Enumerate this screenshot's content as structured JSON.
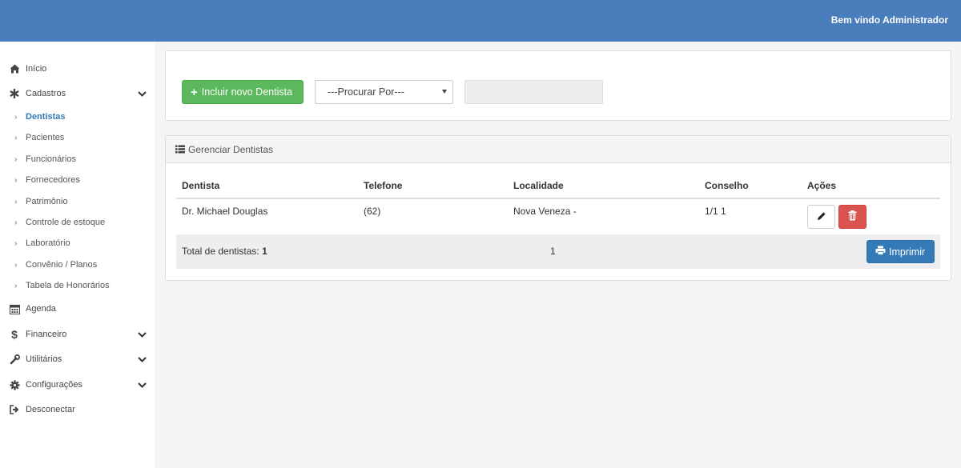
{
  "header": {
    "welcome": "Bem vindo Administrador",
    "bar_color": "#4a7dbb"
  },
  "sidebar": {
    "items": [
      {
        "label": "Início",
        "icon": "home-icon"
      },
      {
        "label": "Cadastros",
        "icon": "asterisk-icon",
        "expanded": true
      },
      {
        "label": "Agenda",
        "icon": "calendar-icon"
      },
      {
        "label": "Financeiro",
        "icon": "dollar-icon"
      },
      {
        "label": "Utilitários",
        "icon": "wrench-icon"
      },
      {
        "label": "Configurações",
        "icon": "gear-icon"
      },
      {
        "label": "Desconectar",
        "icon": "sign-out-icon"
      }
    ],
    "subitems": [
      {
        "label": "Dentistas",
        "active": true
      },
      {
        "label": "Pacientes"
      },
      {
        "label": "Funcionários"
      },
      {
        "label": "Fornecedores"
      },
      {
        "label": "Patrimônio"
      },
      {
        "label": "Controle de estoque"
      },
      {
        "label": "Laboratório"
      },
      {
        "label": "Convênio / Planos"
      },
      {
        "label": "Tabela de Honorários"
      }
    ],
    "active_color": "#337ab7"
  },
  "toolbar": {
    "add_label": "Incluir novo Dentista",
    "search_by": "---Procurar Por---",
    "search_value": "",
    "search_placeholder": ""
  },
  "panel": {
    "title": "Gerenciar Dentistas",
    "columns": [
      "Dentista",
      "Telefone",
      "Localidade",
      "Conselho",
      "Ações"
    ],
    "rows": [
      {
        "dentista": "Dr. Michael Douglas",
        "telefone": "(62)",
        "localidade": "Nova Veneza -",
        "conselho": "1/1 1"
      }
    ],
    "total_label": "Total de dentistas:",
    "total_value": "1",
    "page": "1",
    "print_label": "Imprimir"
  },
  "colors": {
    "add": "#5cb85c",
    "delete": "#d9534f",
    "print": "#337ab7"
  }
}
